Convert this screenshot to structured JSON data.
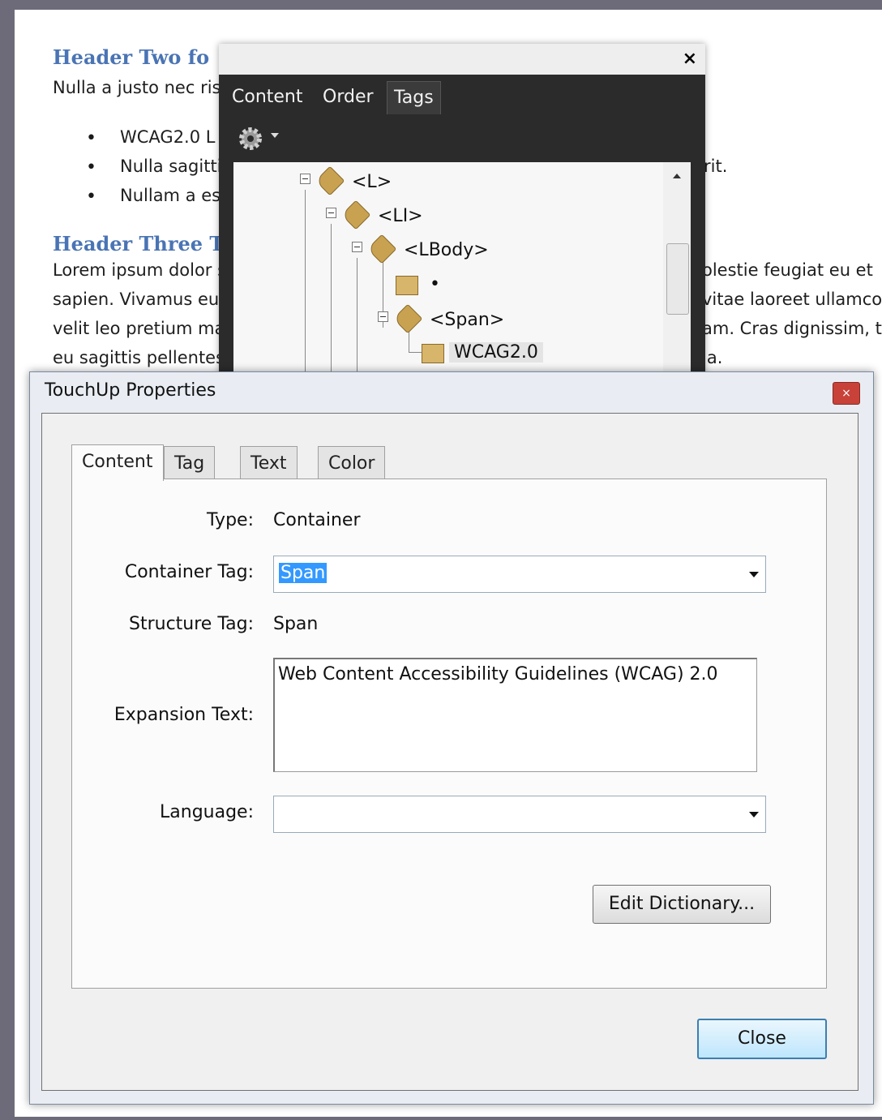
{
  "document": {
    "heading_two": "Header Two fo",
    "para_one": "Nulla a justo nec ris",
    "bullets": [
      "WCAG2.0 L",
      "Nulla sagitti",
      "Nullam a es"
    ],
    "bullet_tail": "rit.",
    "heading_three": "Header Three Tex",
    "lines_left": [
      "Lorem ipsum dolor s",
      "sapien. Vivamus eu",
      "velit leo pretium ma",
      "eu sagittis pellentes"
    ],
    "lines_right": [
      "olestie feugiat eu et",
      "vitae laoreet ullamco",
      "am. Cras dignissim, t",
      "la."
    ]
  },
  "tags_panel": {
    "close_glyph": "×",
    "tabs": [
      "Content",
      "Order",
      "Tags"
    ],
    "active_tab": "Tags",
    "options_icon": "gear-icon",
    "tree": [
      {
        "label": "<L>",
        "icon": "tag-icon"
      },
      {
        "label": "<LI>",
        "icon": "tag-icon"
      },
      {
        "label": "<LBody>",
        "icon": "tag-icon"
      },
      {
        "label": "•",
        "icon": "container-icon"
      },
      {
        "label": "<Span>",
        "icon": "tag-icon"
      },
      {
        "label": "WCAG2.0",
        "icon": "container-icon",
        "selected": true
      }
    ]
  },
  "dialog": {
    "title": "TouchUp Properties",
    "close_glyph": "×",
    "tabs": [
      "Content",
      "Tag",
      "Text",
      "Color"
    ],
    "active_tab": "Content",
    "fields": {
      "type_label": "Type:",
      "type_value": "Container",
      "container_tag_label": "Container Tag:",
      "container_tag_value": "Span",
      "structure_tag_label": "Structure Tag:",
      "structure_tag_value": "Span",
      "expansion_text_label": "Expansion Text:",
      "expansion_text_value": "Web Content Accessibility Guidelines (WCAG) 2.0",
      "language_label": "Language:",
      "language_value": ""
    },
    "edit_dictionary_label": "Edit Dictionary...",
    "close_label": "Close"
  }
}
